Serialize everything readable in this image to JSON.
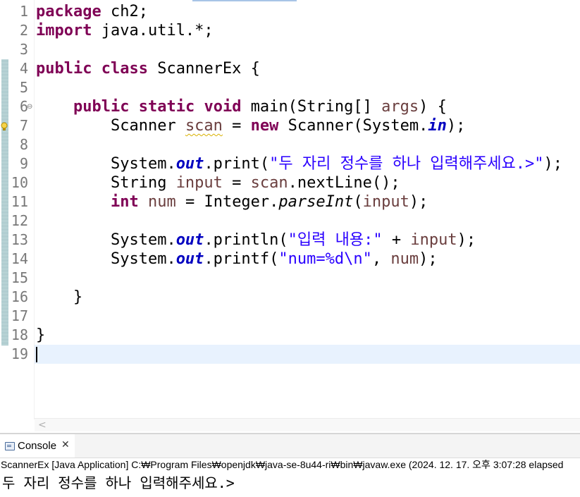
{
  "editor": {
    "line_numbers": [
      "1",
      "2",
      "3",
      "4",
      "5",
      "6",
      "7",
      "8",
      "9",
      "10",
      "11",
      "12",
      "13",
      "14",
      "15",
      "16",
      "17",
      "18",
      "19"
    ],
    "l1": {
      "kw": "package",
      "rest": " ch2;"
    },
    "l2": {
      "kw": "import",
      "rest": " java.util.*;"
    },
    "l4": {
      "kw1": "public",
      "kw2": "class",
      "rest": " ScannerEx {"
    },
    "l6": {
      "indent": "    ",
      "kw1": "public",
      "kw2": "static",
      "kw3": "void",
      "rest1": " main(String[] ",
      "param": "args",
      "rest2": ") {"
    },
    "l7": {
      "indent": "        ",
      "type": "Scanner ",
      "var": "scan",
      "eq": " = ",
      "kw": "new",
      "rest": " Scanner(System.",
      "field": "in",
      "end": ");"
    },
    "l9": {
      "indent": "        ",
      "pre": "System.",
      "field": "out",
      "mid": ".print(",
      "str": "\"두 자리 정수를 하나 입력해주세요.>\"",
      "end": ");"
    },
    "l10": {
      "indent": "        ",
      "type": "String ",
      "var": "input",
      "eq": " = ",
      "var2": "scan",
      "rest": ".nextLine();"
    },
    "l11": {
      "indent": "        ",
      "kw": "int",
      "sp": " ",
      "var": "num",
      "mid": " = Integer.",
      "method": "parseInt",
      "open": "(",
      "arg": "input",
      "end": ");"
    },
    "l13": {
      "indent": "        ",
      "pre": "System.",
      "field": "out",
      "mid": ".println(",
      "str": "\"입력 내용:\"",
      "plus": " + ",
      "arg": "input",
      "end": ");"
    },
    "l14": {
      "indent": "        ",
      "pre": "System.",
      "field": "out",
      "mid": ".printf(",
      "str": "\"num=%d\\n\"",
      "comma": ", ",
      "arg": "num",
      "end": ");"
    },
    "l16": {
      "text": "    }"
    },
    "l18": {
      "text": "}"
    }
  },
  "scrollbar": {
    "left_arrow": "<"
  },
  "console": {
    "tab_label": "Console",
    "close_glyph": "✕",
    "header": "ScannerEx [Java Application] C:₩Program Files₩openjdk₩java-se-8u44-ri₩bin₩javaw.exe  (2024. 12. 17. 오후 3:07:28 elapsed",
    "output": "두 자리 정수를 하나 입력해주세요.>"
  },
  "colors": {
    "keyword": "#7f0055",
    "string": "#2a00ff",
    "field": "#0000c0",
    "local_var": "#6a3e3e",
    "current_line": "#e8f2fe"
  }
}
